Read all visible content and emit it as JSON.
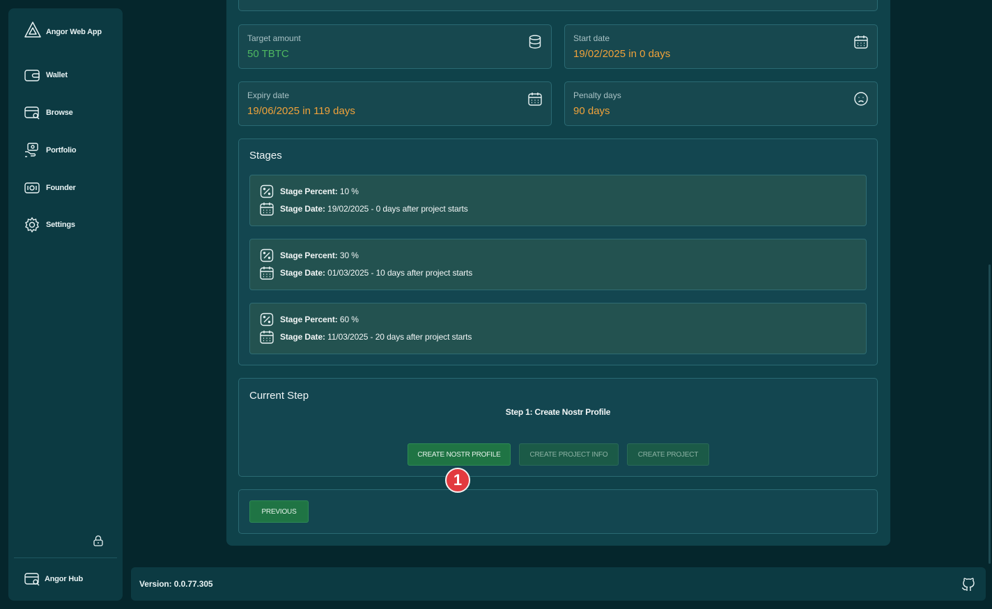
{
  "sidebar": {
    "brand": "Angor Web App",
    "items": [
      {
        "label": "Wallet",
        "icon": "wallet-icon"
      },
      {
        "label": "Browse",
        "icon": "browse-icon"
      },
      {
        "label": "Portfolio",
        "icon": "portfolio-icon"
      },
      {
        "label": "Founder",
        "icon": "founder-icon"
      },
      {
        "label": "Settings",
        "icon": "settings-icon"
      }
    ],
    "hub_label": "Angor Hub"
  },
  "info": {
    "target": {
      "label": "Target amount",
      "value": "50 TBTC"
    },
    "start": {
      "label": "Start date",
      "value": "19/02/2025 in 0 days"
    },
    "expiry": {
      "label": "Expiry date",
      "value": "19/06/2025 in 119 days"
    },
    "penalty": {
      "label": "Penalty days",
      "value": "90 days"
    }
  },
  "stages": {
    "title": "Stages",
    "percent_label": "Stage Percent:",
    "date_label": "Stage Date:",
    "items": [
      {
        "percent": " 10 %",
        "date": " 19/02/2025 - 0 days after project starts"
      },
      {
        "percent": " 30 %",
        "date": " 01/03/2025 - 10 days after project starts"
      },
      {
        "percent": " 60 %",
        "date": " 11/03/2025 - 20 days after project starts"
      }
    ]
  },
  "current_step": {
    "title": "Current Step",
    "step_text": "Step 1: Create Nostr Profile",
    "buttons": [
      "CREATE NOSTR PROFILE",
      "CREATE PROJECT INFO",
      "CREATE PROJECT"
    ],
    "badge": "1"
  },
  "nav": {
    "previous": "PREVIOUS"
  },
  "footer": {
    "version": "Version: 0.0.77.305"
  },
  "colors": {
    "accent_green": "#4fb861",
    "accent_orange": "#f0a23a",
    "badge_red": "#e23a3f"
  }
}
